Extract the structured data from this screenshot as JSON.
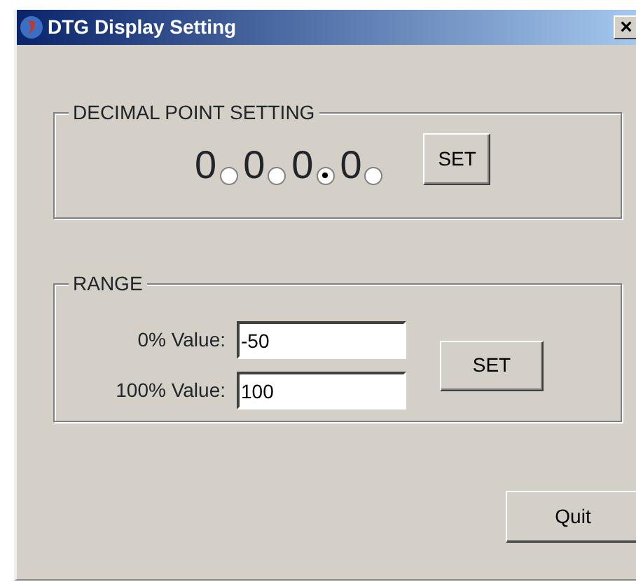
{
  "window": {
    "title": "DTG Display Setting",
    "close": "×"
  },
  "decimal_point": {
    "title": "DECIMAL POINT SETTING",
    "digits": [
      {
        "digit": "0",
        "selected": false
      },
      {
        "digit": "0",
        "selected": false
      },
      {
        "digit": "0",
        "selected": true
      },
      {
        "digit": "0",
        "selected": false
      }
    ],
    "button": "SET"
  },
  "range": {
    "title": "RANGE",
    "fields": [
      {
        "label": "0% Value:",
        "value": "-50"
      },
      {
        "label": "100% Value:",
        "value": "100"
      }
    ],
    "button": "SET"
  },
  "quit": "Quit"
}
